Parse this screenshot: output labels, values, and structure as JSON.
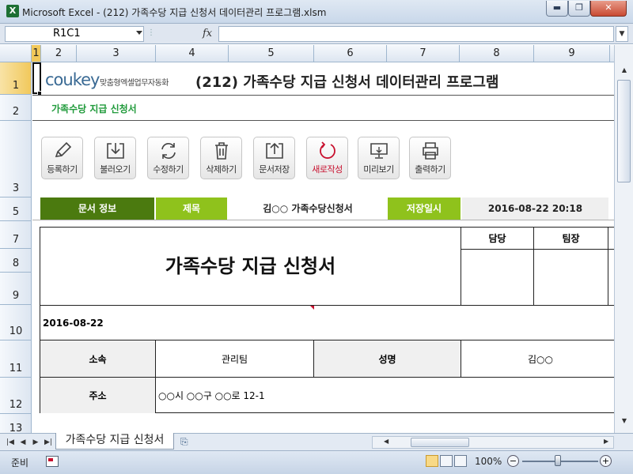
{
  "window": {
    "title": "Microsoft Excel - (212) 가족수당 지급 신청서 데이터관리 프로그램.xlsm",
    "app_icon": "X"
  },
  "formula_bar": {
    "name_box": "R1C1",
    "fx": "fx",
    "formula": ""
  },
  "columns": [
    "1",
    "2",
    "3",
    "4",
    "5",
    "6",
    "7",
    "8",
    "9"
  ],
  "rows": [
    "1",
    "2",
    "3",
    "5",
    "7",
    "8",
    "9",
    "10",
    "11",
    "12",
    "13"
  ],
  "brand": {
    "logo": "coukey",
    "tagline": "맞춤형엑셀업무자동화"
  },
  "program_title": "(212) 가족수당 지급 신청서 데이터관리 프로그램",
  "sheet_label": "가족수당 지급 신청서",
  "toolbar": [
    {
      "label": "등록하기",
      "icon": "pencil-icon"
    },
    {
      "label": "불러오기",
      "icon": "download-tray-icon"
    },
    {
      "label": "수정하기",
      "icon": "refresh-icon"
    },
    {
      "label": "삭제하기",
      "icon": "trash-icon"
    },
    {
      "label": "문서저장",
      "icon": "upload-tray-icon"
    },
    {
      "label": "새로작성",
      "icon": "new-doc-icon",
      "color": "#c8102e"
    },
    {
      "label": "미리보기",
      "icon": "monitor-icon"
    },
    {
      "label": "출력하기",
      "icon": "printer-icon"
    }
  ],
  "info_bar": {
    "doc_info": "문서 정보",
    "title_label": "제목",
    "title_value": "김○○ 가족수당신청서",
    "date_label": "저장일시",
    "date_value": "2016-08-22 20:18"
  },
  "form": {
    "heading": "가족수당 지급 신청서",
    "approval": [
      "담당",
      "팀장"
    ],
    "date": "2016-08-22",
    "row1": {
      "dept_label": "소속",
      "dept_value": "관리팀",
      "name_label": "성명",
      "name_value": "김○○"
    },
    "row2": {
      "addr_label": "주소",
      "addr_value": "○○시 ○○구 ○○로 12-1"
    }
  },
  "sheet_tab": "가족수당 지급 신청서",
  "status": {
    "ready": "준비",
    "zoom": "100%"
  },
  "colors": {
    "green_dark": "#4b7a0f",
    "green_light": "#8fc21c",
    "accent_red": "#c8102e",
    "label_green": "#1f9a3a"
  }
}
